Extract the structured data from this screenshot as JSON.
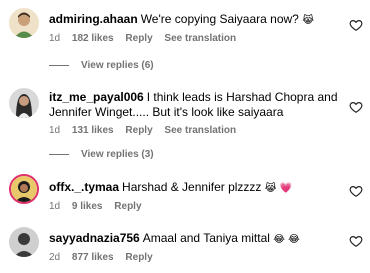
{
  "comments": [
    {
      "username": "admiring.ahaan",
      "text": "We're copying Saiyaara now?",
      "emoji": "😹",
      "time": "1d",
      "likes": "182 likes",
      "reply": "Reply",
      "translate": "See translation",
      "view_replies": "View replies (6)",
      "avatar_colors": [
        "#f0e2c8",
        "#5a8a4a"
      ]
    },
    {
      "username": "itz_me_payal006",
      "text": "I think leads is Harshad Chopra and Jennifer Winget..... But it's look like saiyaara",
      "emoji": "",
      "time": "1d",
      "likes": "131 likes",
      "reply": "Reply",
      "translate": "See translation",
      "view_replies": "View replies (3)",
      "avatar_colors": [
        "#d9d9d9",
        "#2b2b2b"
      ]
    },
    {
      "username": "offx._.tymaa",
      "text": "Harshad & Jennifer plzzzz",
      "emoji": "😹 💗",
      "time": "1d",
      "likes": "9 likes",
      "reply": "Reply",
      "avatar_colors": [
        "#e8c86a",
        "#1b1b1b"
      ]
    },
    {
      "username": "sayyadnazia756",
      "text": "Amaal and Taniya mittal",
      "emoji": "😂 😂",
      "time": "2d",
      "likes": "877 likes",
      "reply": "Reply",
      "avatar_colors": [
        "#cfcfcf",
        "#3a3a3a"
      ]
    }
  ],
  "icons": {
    "like": "heart-outline-icon"
  },
  "colors": {
    "text": "#000000",
    "secondary": "#737373",
    "background": "#ffffff"
  }
}
